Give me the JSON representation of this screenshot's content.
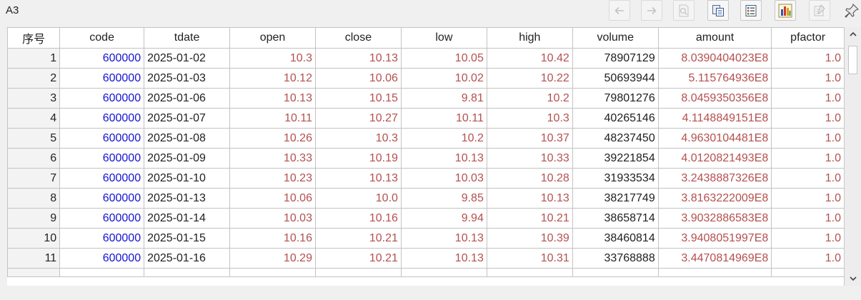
{
  "cell_name": "A3",
  "toolbar": {
    "buttons": [
      {
        "icon": "arrow-left-icon",
        "enabled": false
      },
      {
        "icon": "arrow-right-icon",
        "enabled": false
      },
      {
        "icon": "search-page-icon",
        "enabled": false
      },
      {
        "icon": "copy-icon",
        "enabled": true
      },
      {
        "icon": "list-icon",
        "enabled": true
      },
      {
        "icon": "bar-chart-icon",
        "enabled": true
      },
      {
        "icon": "properties-icon",
        "enabled": false
      },
      {
        "icon": "pin-icon",
        "enabled": true
      }
    ]
  },
  "grid": {
    "columns": [
      "序号",
      "code",
      "tdate",
      "open",
      "close",
      "low",
      "high",
      "volume",
      "amount",
      "pfactor"
    ],
    "rows": [
      [
        "1",
        "600000",
        "2025-01-02",
        "10.3",
        "10.13",
        "10.05",
        "10.42",
        "78907129",
        "8.0390404023E8",
        "1.0"
      ],
      [
        "2",
        "600000",
        "2025-01-03",
        "10.12",
        "10.06",
        "10.02",
        "10.22",
        "50693944",
        "5.115764936E8",
        "1.0"
      ],
      [
        "3",
        "600000",
        "2025-01-06",
        "10.13",
        "10.15",
        "9.81",
        "10.2",
        "79801276",
        "8.0459350356E8",
        "1.0"
      ],
      [
        "4",
        "600000",
        "2025-01-07",
        "10.11",
        "10.27",
        "10.11",
        "10.3",
        "40265146",
        "4.1148849151E8",
        "1.0"
      ],
      [
        "5",
        "600000",
        "2025-01-08",
        "10.26",
        "10.3",
        "10.2",
        "10.37",
        "48237450",
        "4.9630104481E8",
        "1.0"
      ],
      [
        "6",
        "600000",
        "2025-01-09",
        "10.33",
        "10.19",
        "10.13",
        "10.33",
        "39221854",
        "4.0120821493E8",
        "1.0"
      ],
      [
        "7",
        "600000",
        "2025-01-10",
        "10.23",
        "10.13",
        "10.03",
        "10.28",
        "31933534",
        "3.2438887326E8",
        "1.0"
      ],
      [
        "8",
        "600000",
        "2025-01-13",
        "10.06",
        "10.0",
        "9.85",
        "10.13",
        "38217749",
        "3.8163222009E8",
        "1.0"
      ],
      [
        "9",
        "600000",
        "2025-01-14",
        "10.03",
        "10.16",
        "9.94",
        "10.21",
        "38658714",
        "3.9032886583E8",
        "1.0"
      ],
      [
        "10",
        "600000",
        "2025-01-15",
        "10.16",
        "10.21",
        "10.13",
        "10.39",
        "38460814",
        "3.9408051997E8",
        "1.0"
      ],
      [
        "11",
        "600000",
        "2025-01-16",
        "10.29",
        "10.21",
        "10.13",
        "10.31",
        "33768888",
        "3.4470814969E8",
        "1.0"
      ]
    ]
  },
  "colors": {
    "code_text": "#1414d2",
    "numeric_text": "#b4504e",
    "default_text": "#202020",
    "grid_line": "#c3c3c3"
  }
}
